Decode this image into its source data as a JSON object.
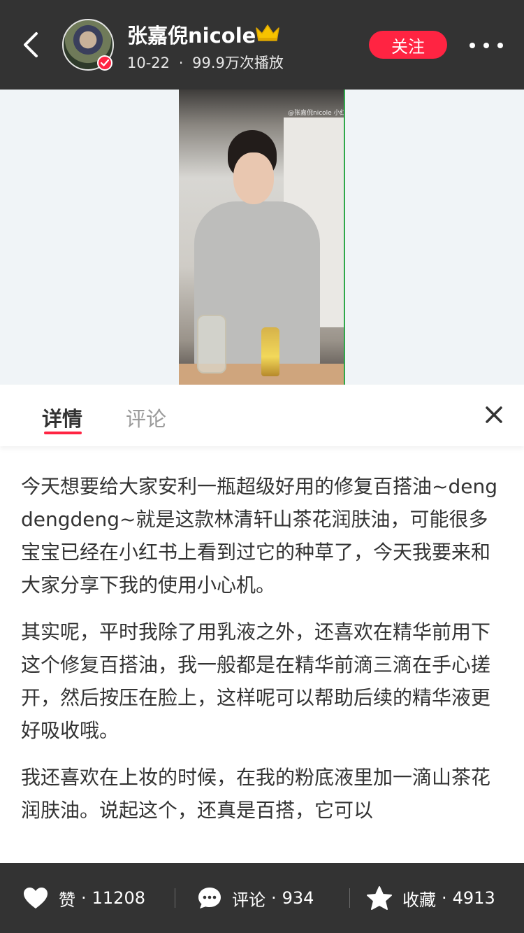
{
  "header": {
    "author_name": "张嘉倪nicole",
    "post_date": "10-22",
    "meta_separator": "·",
    "play_count": "99.9万次播放",
    "follow_label": "关注",
    "icons": [
      "back-arrow-icon",
      "verified-icon",
      "crown-icon",
      "more-icon"
    ]
  },
  "video": {
    "watermark": "@张嘉倪nicole  小红书"
  },
  "tabs": [
    {
      "label": "详情",
      "active": true
    },
    {
      "label": "评论",
      "active": false
    }
  ],
  "content": {
    "paragraphs": [
      "今天想要给大家安利一瓶超级好用的修复百搭油~dengdengdeng~就是这款林清轩山茶花润肤油，可能很多宝宝已经在小红书上看到过它的种草了，今天我要来和大家分享下我的使用小心机。",
      "其实呢，平时我除了用乳液之外，还喜欢在精华前用下这个修复百搭油，我一般都是在精华前滴三滴在手心搓开，然后按压在脸上，这样呢可以帮助后续的精华液更好吸收哦。",
      "我还喜欢在上妆的时候，在我的粉底液里加一滴山茶花润肤油。说起这个，还真是百搭，它可以"
    ]
  },
  "bottom_bar": {
    "like": {
      "label": "赞",
      "count": "11208"
    },
    "comment": {
      "label": "评论",
      "count": "934"
    },
    "collect": {
      "label": "收藏",
      "count": "4913"
    },
    "separator": "·"
  },
  "colors": {
    "accent": "#ff2442",
    "header_bg": "#333333",
    "media_bg": "#f0f4f7",
    "crown": "#f7c300"
  }
}
